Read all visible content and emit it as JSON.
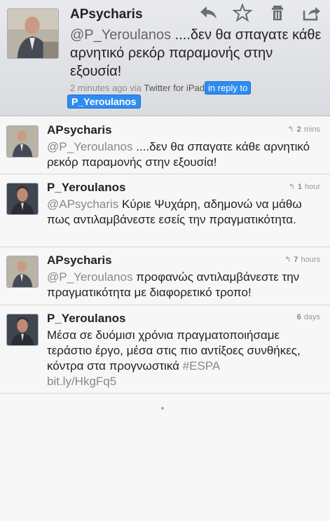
{
  "header": {
    "user": "APsycharis",
    "mention": "@P_Yeroulanos",
    "text": " ....δεν θα σπαγατε κάθε αρνητικό ρεκόρ παραμονής στην εξουσία!",
    "time": "2 minutes ago",
    "via": "via",
    "source": "Twitter for iPad",
    "in_reply_to": "in reply to",
    "reply_user": "P_Yeroulanos"
  },
  "actions": {
    "icons": [
      "reply-icon",
      "star-icon",
      "trash-icon",
      "share-icon"
    ]
  },
  "tweets": [
    {
      "user": "APsycharis",
      "time_num": "2",
      "time_unit": "mins",
      "mention": "@P_Yeroulanos",
      "text": " ....δεν θα σπαγατε κάθε αρνητικό ρεκόρ παραμονής στην εξουσία!"
    },
    {
      "user": "P_Yeroulanos",
      "time_num": "1",
      "time_unit": "hour",
      "mention": "@APsycharis",
      "text": " Κύριε Ψυχάρη, αδημονώ να μάθω πως αντιλαμβάνεστε εσείς την πραγματικότητα."
    },
    {
      "user": "APsycharis",
      "time_num": "7",
      "time_unit": "hours",
      "mention": "@P_Yeroulanos",
      "text": " προφανώς αντιλαμβάνεστε την πραγματικότητα με διαφορετικό τροπο!"
    },
    {
      "user": "P_Yeroulanos",
      "time_num": "6",
      "time_unit": "days",
      "text": "Μέσα σε δυόμισι χρόνια πραγματοποιήσαμε τεράστιο έργο, μέσα στις πιο αντίξοες συνθήκες, κόντρα στα προγνωστικά ",
      "hashtag": "#ESPA",
      "link": "bit.ly/HkgFq5"
    }
  ],
  "colors": {
    "selection": "#2f8cf0",
    "muted": "#888888"
  }
}
